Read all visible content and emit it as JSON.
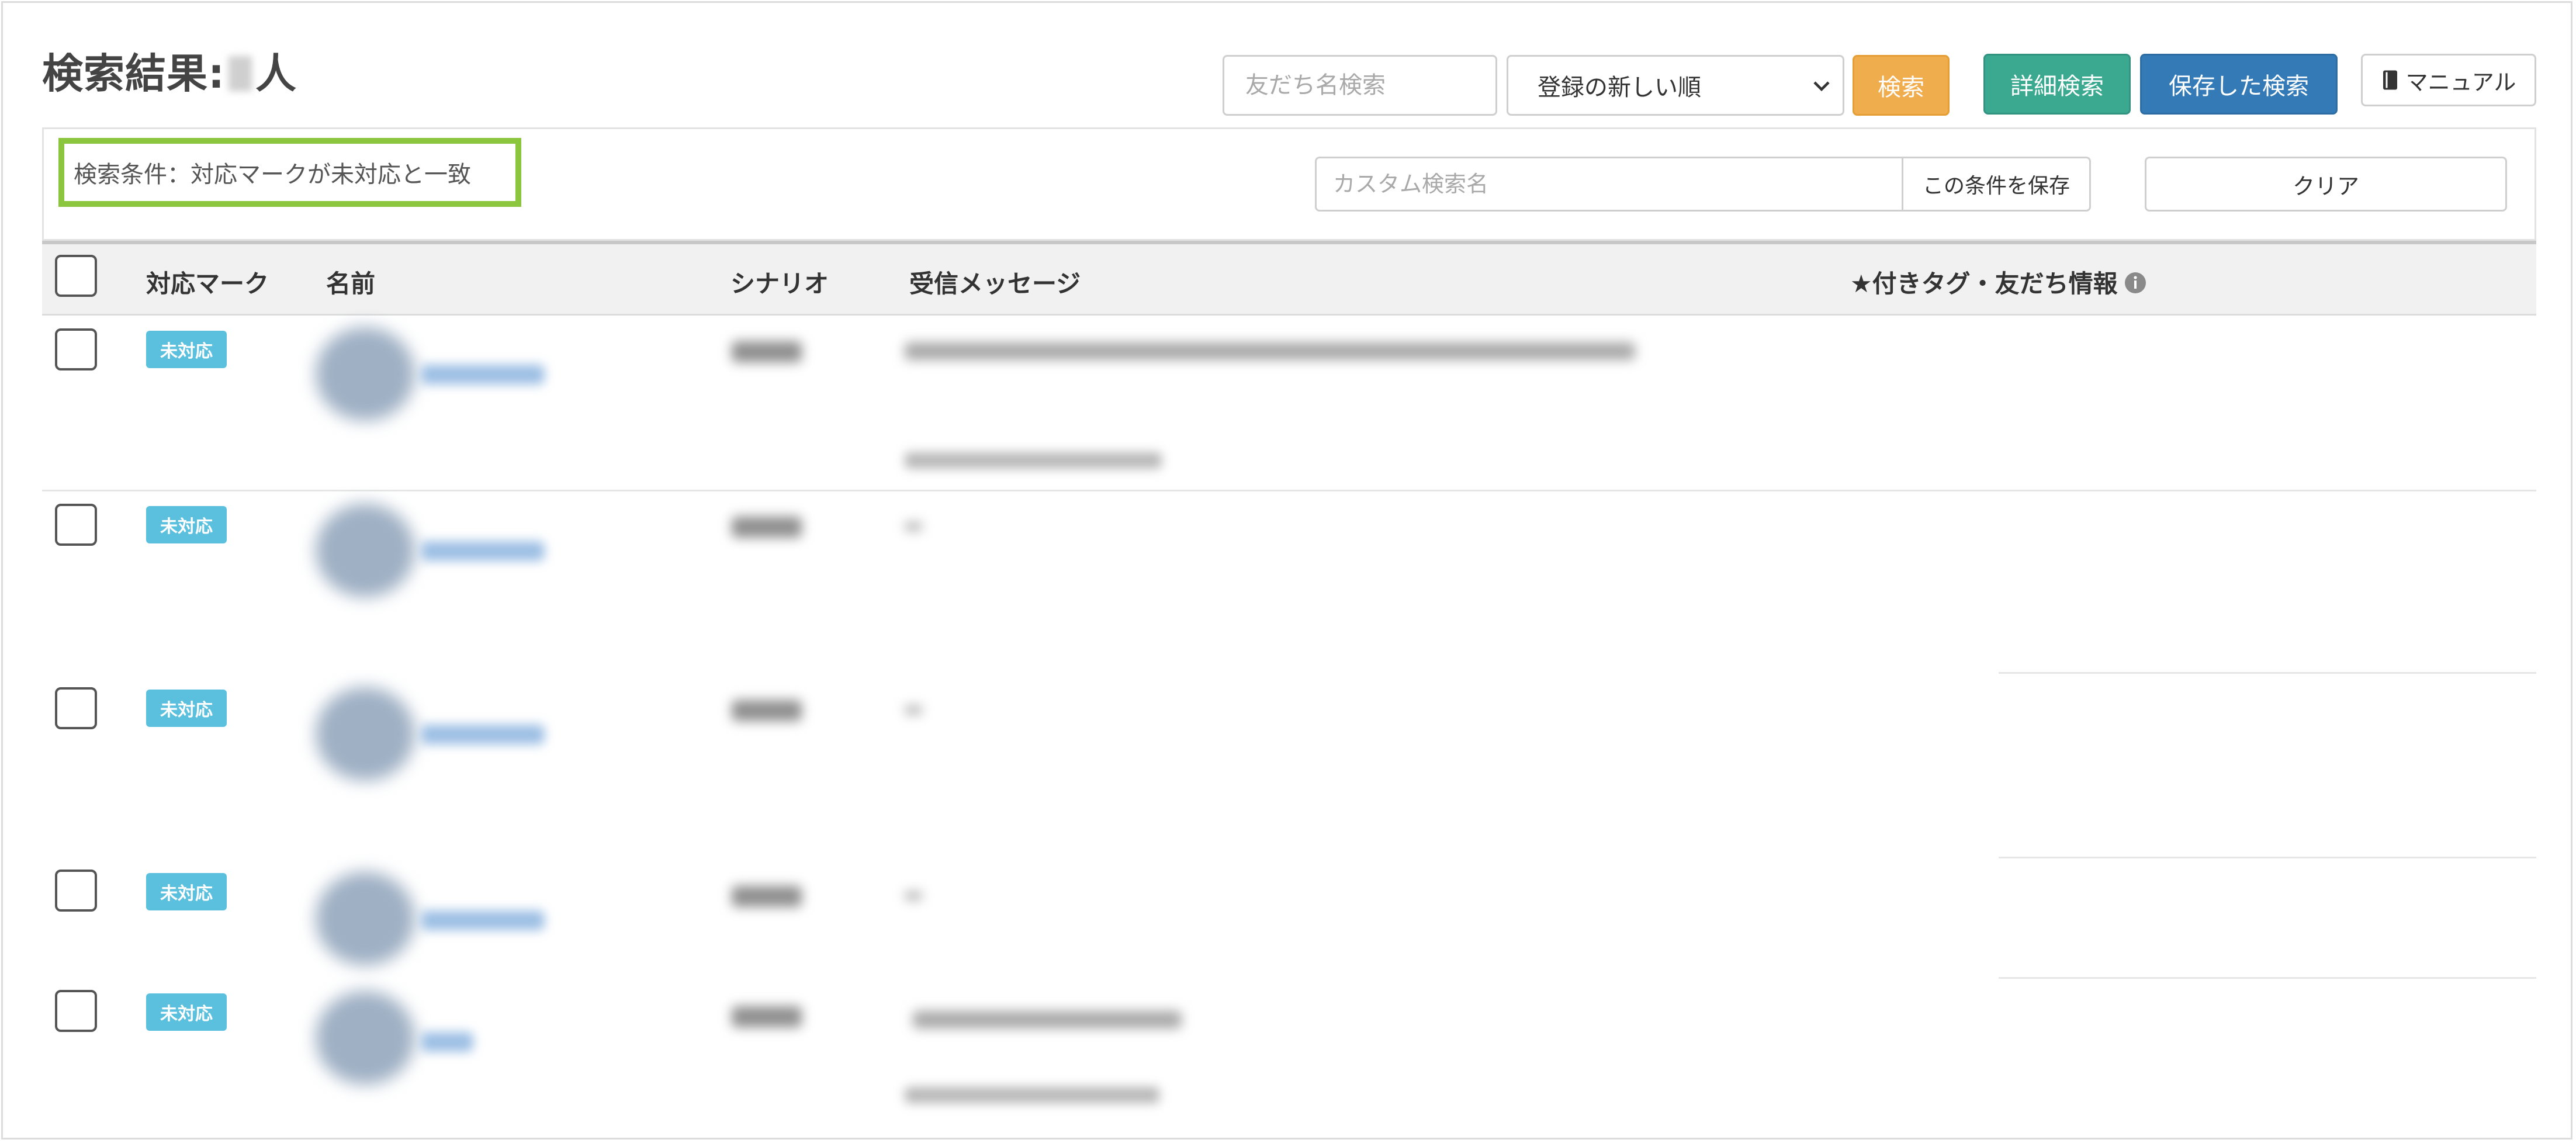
{
  "header": {
    "title_prefix": "検索結果:",
    "title_suffix": "人"
  },
  "toolbar": {
    "search_placeholder": "友だち名検索",
    "sort_selected": "登録の新しい順",
    "search_label": "検索",
    "detail_search_label": "詳細検索",
    "saved_search_label": "保存した検索",
    "manual_label": "マニュアル"
  },
  "conditions": {
    "text": "検索条件：対応マークが未対応と一致",
    "custom_name_placeholder": "カスタム検索名",
    "save_label": "この条件を保存",
    "clear_label": "クリア"
  },
  "table": {
    "headers": {
      "mark": "対応マーク",
      "name": "名前",
      "scenario": "シナリオ",
      "message": "受信メッセージ",
      "tags": "★付きタグ・友だち情報"
    },
    "rows": [
      {
        "mark": "未対応"
      },
      {
        "mark": "未対応"
      },
      {
        "mark": "未対応"
      },
      {
        "mark": "未対応"
      },
      {
        "mark": "未対応"
      }
    ]
  },
  "colors": {
    "search_button": "#f0ad4e",
    "detail_button": "#3aa98f",
    "saved_button": "#337ab7",
    "badge": "#5bc0de",
    "highlight_border": "#8cc63f"
  }
}
